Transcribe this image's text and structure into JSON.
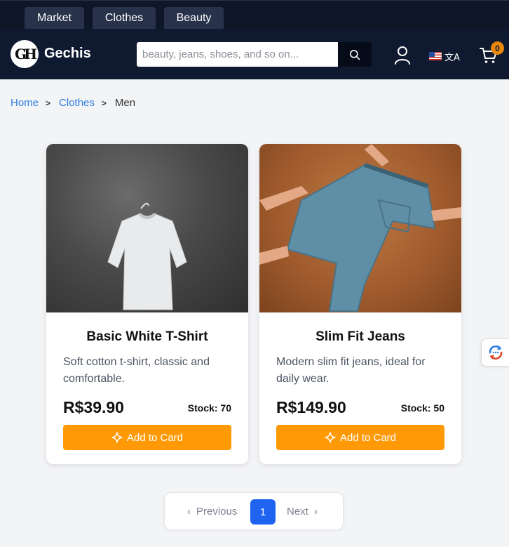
{
  "top_tabs": [
    {
      "label": "Market"
    },
    {
      "label": "Clothes"
    },
    {
      "label": "Beauty"
    }
  ],
  "header": {
    "logo_text": "GH",
    "brand": "Gechis",
    "search": {
      "placeholder": "beauty, jeans, shoes, and so on...",
      "value": ""
    },
    "cart_count": "0",
    "icons": {
      "search": "search-icon",
      "user": "user-icon",
      "language": "translate-icon",
      "cart": "cart-icon"
    }
  },
  "breadcrumb": {
    "items": [
      "Home",
      "Clothes"
    ],
    "current": "Men"
  },
  "products": [
    {
      "title": "Basic White T-Shirt",
      "description": "Soft cotton t-shirt, classic and comfortable.",
      "price": "R$39.90",
      "stock": "Stock: 70",
      "button": "Add to Card"
    },
    {
      "title": "Slim Fit Jeans",
      "description": "Modern slim fit jeans, ideal for daily wear.",
      "price": "R$149.90",
      "stock": "Stock: 50",
      "button": "Add to Card"
    }
  ],
  "pagination": {
    "previous": "Previous",
    "current": "1",
    "next": "Next"
  },
  "colors": {
    "header_bg": "#0f1a30",
    "accent_button": "#ff9a06",
    "link": "#2f7de1",
    "pagination_active": "#1e64f0",
    "cart_badge": "#e8870e"
  }
}
